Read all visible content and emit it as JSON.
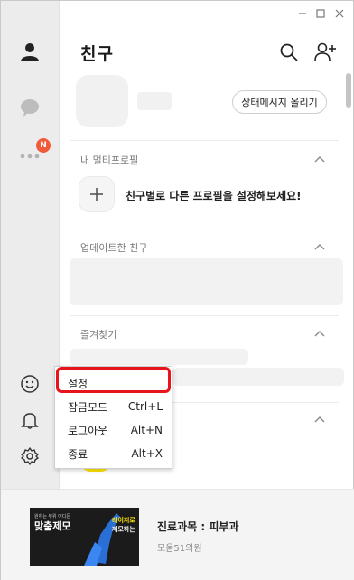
{
  "window_controls": {
    "minimize": "minimize-icon",
    "maximize": "maximize-icon",
    "close": "close-icon"
  },
  "rail": {
    "items": [
      {
        "name": "friends",
        "icon": "person-icon"
      },
      {
        "name": "chats",
        "icon": "chat-bubble-icon"
      },
      {
        "name": "more",
        "icon": "more-dots-icon",
        "badge": "N"
      }
    ],
    "bottom": [
      {
        "name": "emoticon",
        "icon": "smiley-icon"
      },
      {
        "name": "notifications",
        "icon": "bell-icon"
      },
      {
        "name": "settings",
        "icon": "gear-icon"
      }
    ]
  },
  "header": {
    "title": "친구",
    "search_icon": "search-icon",
    "add_friend_icon": "add-friend-icon"
  },
  "profile": {
    "status_button": "상태메시지 올리기"
  },
  "sections": {
    "multi_profile": "내 멀티프로필",
    "multi_profile_cta": "친구별로 다른 프로필을 설정해보세요!",
    "updated_friends": "업데이트한 친구",
    "favorites": "즐겨찾기"
  },
  "menu": {
    "items": [
      {
        "label": "설정",
        "shortcut": ""
      },
      {
        "label": "잠금모드",
        "shortcut": "Ctrl+L"
      },
      {
        "label": "로그아웃",
        "shortcut": "Alt+N"
      },
      {
        "label": "종료",
        "shortcut": "Alt+X"
      }
    ]
  },
  "ad": {
    "image_lines": [
      "원하는 부위 어디든",
      "맞춤제모",
      "레이저로",
      "제모하는"
    ],
    "title": "진료과목 : 피부과",
    "subtitle": "모움51의원"
  },
  "colors": {
    "accent_red": "#e8141b",
    "badge": "#f25a3c",
    "kakao_yellow": "#fee500"
  }
}
